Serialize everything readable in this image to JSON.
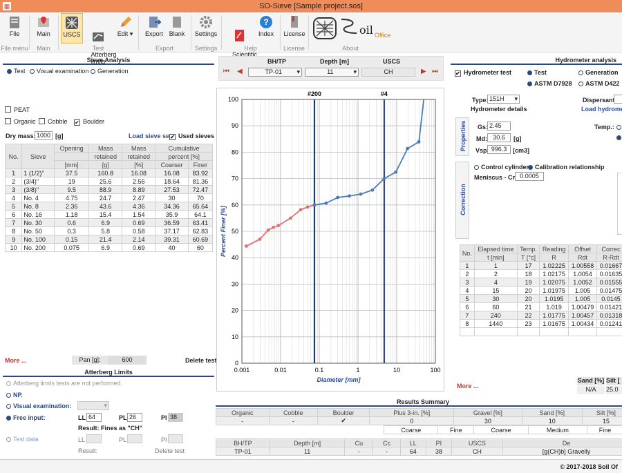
{
  "window": {
    "title": "SO-Sieve [Sample project.sos]"
  },
  "ribbon": {
    "buttons": [
      {
        "label": "File",
        "icon": "file-icon"
      },
      {
        "label": "Main",
        "icon": "map-pin-icon"
      },
      {
        "label": "USCS",
        "icon": "uscs-grid-icon"
      },
      {
        "label": "Atterberg\nlimits",
        "icon": "atterberg-icon"
      },
      {
        "label": "Edit",
        "icon": "pencil-icon"
      },
      {
        "label": "Export",
        "icon": "export-icon"
      },
      {
        "label": "Blank",
        "icon": "blank-page-icon"
      },
      {
        "label": "Settings",
        "icon": "gear-icon"
      },
      {
        "label": "Scientific\nmanual",
        "icon": "pdf-icon"
      },
      {
        "label": "Index",
        "icon": "help-icon"
      },
      {
        "label": "License",
        "icon": "license-icon"
      }
    ],
    "groups": [
      "File menu",
      "Main",
      "Test",
      "Export",
      "Settings",
      "Help",
      "License",
      "About"
    ],
    "about_logo": "oil",
    "about_logo_sub": "Office"
  },
  "sieve": {
    "title": "Sieve Analysis",
    "radios": [
      "Test",
      "Visual examination",
      "Generation"
    ],
    "peat": "PEAT",
    "organic": "Organic",
    "cobble": "Cobble",
    "boulder": "Boulder",
    "dry_mass_label": "Dry mass:",
    "dry_mass_value": "1000",
    "dry_mass_unit": "[g]",
    "load_set": "Load sieve set",
    "used_sieves": "Used sieves",
    "headers": {
      "no": "No.",
      "sieve": "Sieve",
      "opening": "Opening",
      "opening_unit": "[mm]",
      "mass": "Mass",
      "mass2": "retained",
      "mass_unit": "[g]",
      "massp": "Mass",
      "massp2": "retained",
      "massp_unit": "[%]",
      "cum": "Cumulative",
      "cum2": "percent [%]",
      "coarser": "Coarser",
      "finer": "Finer"
    },
    "rows": [
      [
        "1",
        "1 (1/2)\"",
        "37.5",
        "160.8",
        "16.08",
        "16.08",
        "83.92"
      ],
      [
        "2",
        "(3/4)\"",
        "19",
        "25.6",
        "2.56",
        "18.64",
        "81.36"
      ],
      [
        "3",
        "(3/8)\"",
        "9.5",
        "88.9",
        "8.89",
        "27.53",
        "72.47"
      ],
      [
        "4",
        "No. 4",
        "4.75",
        "24.7",
        "2.47",
        "30",
        "70"
      ],
      [
        "5",
        "No. 8",
        "2.36",
        "43.6",
        "4.36",
        "34.36",
        "65.64"
      ],
      [
        "6",
        "No. 16",
        "1.18",
        "15.4",
        "1.54",
        "35.9",
        "64.1"
      ],
      [
        "7",
        "No. 30",
        "0.6",
        "6.9",
        "0.69",
        "36.59",
        "63.41"
      ],
      [
        "8",
        "No. 50",
        "0.3",
        "5.8",
        "0.58",
        "37.17",
        "62.83"
      ],
      [
        "9",
        "No. 100",
        "0.15",
        "21.4",
        "2.14",
        "39.31",
        "60.69"
      ],
      [
        "10",
        "No. 200",
        "0.075",
        "6.9",
        "0.69",
        "40",
        "60"
      ]
    ],
    "more": "More ...",
    "pan_label": "Pan [g]:",
    "pan_value": "600",
    "delete": "Delete test"
  },
  "atterberg": {
    "title": "Atterberg Limits",
    "not_performed": "Atterberg limits tests are not performed.",
    "np": "NP.",
    "visual": "Visual examination:",
    "free": "Free input:",
    "ll": "LL",
    "ll_value": "64",
    "pl": "PL",
    "pl_value": "26",
    "pi": "PI",
    "pi_value": "38",
    "result": "Result: Fines as \"CH\"",
    "test_data": "Test data",
    "result2": "Result:",
    "delete": "Delete test"
  },
  "nav": {
    "bh_label": "BH/TP",
    "bh_value": "TP-01",
    "depth_label": "Depth [m]",
    "depth_value": "11",
    "uscs_label": "USCS",
    "uscs_value": "CH"
  },
  "chart_data": {
    "type": "line",
    "xlabel": "Diameter [mm]",
    "ylabel": "Percent Finer [%]",
    "xscale": "log",
    "xlim": [
      0.001,
      100
    ],
    "ylim": [
      0,
      100
    ],
    "xticks": [
      "0.001",
      "0.01",
      "0.1",
      "1",
      "10",
      "100"
    ],
    "yticks": [
      "0",
      "10",
      "20",
      "30",
      "40",
      "50",
      "60",
      "70",
      "80",
      "90",
      "100"
    ],
    "markers": [
      {
        "label": "#200",
        "x": 0.075
      },
      {
        "label": "#4",
        "x": 4.75
      }
    ],
    "series": [
      {
        "color": "#e07070",
        "points": [
          [
            0.0013,
            44.4
          ],
          [
            0.0029,
            47
          ],
          [
            0.0048,
            50.5
          ],
          [
            0.0065,
            51.5
          ],
          [
            0.0088,
            52.2
          ],
          [
            0.018,
            55
          ],
          [
            0.033,
            58.2
          ],
          [
            0.05,
            59.2
          ],
          [
            0.075,
            60
          ]
        ]
      },
      {
        "color": "#4a7ab8",
        "points": [
          [
            0.075,
            60
          ],
          [
            0.15,
            60.69
          ],
          [
            0.3,
            62.83
          ],
          [
            0.6,
            63.41
          ],
          [
            1.18,
            64.1
          ],
          [
            2.36,
            65.64
          ],
          [
            4.75,
            70
          ],
          [
            9.5,
            72.47
          ],
          [
            19,
            81.36
          ],
          [
            37.5,
            83.92
          ],
          [
            50,
            100
          ]
        ]
      }
    ]
  },
  "hydro": {
    "title": "Hydrometer analysis",
    "test": "Hydrometer test",
    "r_test": "Test",
    "r_gen": "Generation",
    "astm1": "ASTM D7928",
    "astm2": "ASTM D422",
    "type_label": "Type:",
    "type_value": "151H",
    "dispersant": "Dispersant:",
    "details": "Hydrometer details",
    "load": "Load hydrometer",
    "properties": "Properties",
    "gs_label": "Gs:",
    "gs": "2.45",
    "md_label": "Md:",
    "md": "30.6",
    "md_unit": "[g]",
    "vsp_label": "Vsp:",
    "vsp": "996.3",
    "vsp_unit": "[cm3]",
    "temp": "Temp.:",
    "correction": "Correction",
    "control": "Control cylinder",
    "calib": "Calibration relationship",
    "meniscus": "Meniscus - Cm:",
    "meniscus_value": "0.0005",
    "headers": {
      "no": "No.",
      "et": "Elapsed time",
      "et2": "t [min]",
      "temp": "Temp.",
      "temp2": "T [°c]",
      "read": "Reading",
      "read2": "R",
      "off": "Offset",
      "off2": "Rdt",
      "corr": "Correc",
      "corr2": "R-Rdt"
    },
    "rows": [
      [
        "1",
        "1",
        "17",
        "1.02225",
        "1.00558",
        "0.01667"
      ],
      [
        "2",
        "2",
        "18",
        "1.02175",
        "1.0054",
        "0.01635"
      ],
      [
        "3",
        "4",
        "19",
        "1.02075",
        "1.0052",
        "0.01555"
      ],
      [
        "4",
        "15",
        "20",
        "1.01975",
        "1.005",
        "0.01475"
      ],
      [
        "5",
        "30",
        "20",
        "1.0195",
        "1.005",
        "0.0145"
      ],
      [
        "6",
        "60",
        "21",
        "1.019",
        "1.00479",
        "0.01421"
      ],
      [
        "7",
        "240",
        "22",
        "1.01775",
        "1.00457",
        "0.01318"
      ],
      [
        "8",
        "1440",
        "23",
        "1.01675",
        "1.00434",
        "0.01241"
      ]
    ],
    "more": "More ...",
    "sand_label": "Sand [%]",
    "sand_value": "N/A",
    "silt_label": "Silt [",
    "silt_value": "25.0"
  },
  "results": {
    "title": "Results Summary",
    "h1": [
      "Organic",
      "Cobble",
      "Boulder",
      "Plus 3-in. [%]",
      "Gravel [%]",
      "Sand [%]",
      "Silt [%]"
    ],
    "v1": [
      "-",
      "-",
      "✔",
      "0",
      "30",
      "10",
      "15"
    ],
    "sub": [
      "Coarse",
      "Fine",
      "Coarse",
      "Medium",
      "Fine"
    ],
    "h2": [
      "BH/TP",
      "Depth [m]",
      "Cu",
      "Cc",
      "LL",
      "PI",
      "USCS",
      "De"
    ],
    "v2": [
      "TP-01",
      "11",
      "-",
      "-",
      "64",
      "38",
      "CH",
      "[g(CH)b] Gravelly"
    ]
  },
  "status": {
    "copyright": "© 2017-2018 Soil Of"
  }
}
